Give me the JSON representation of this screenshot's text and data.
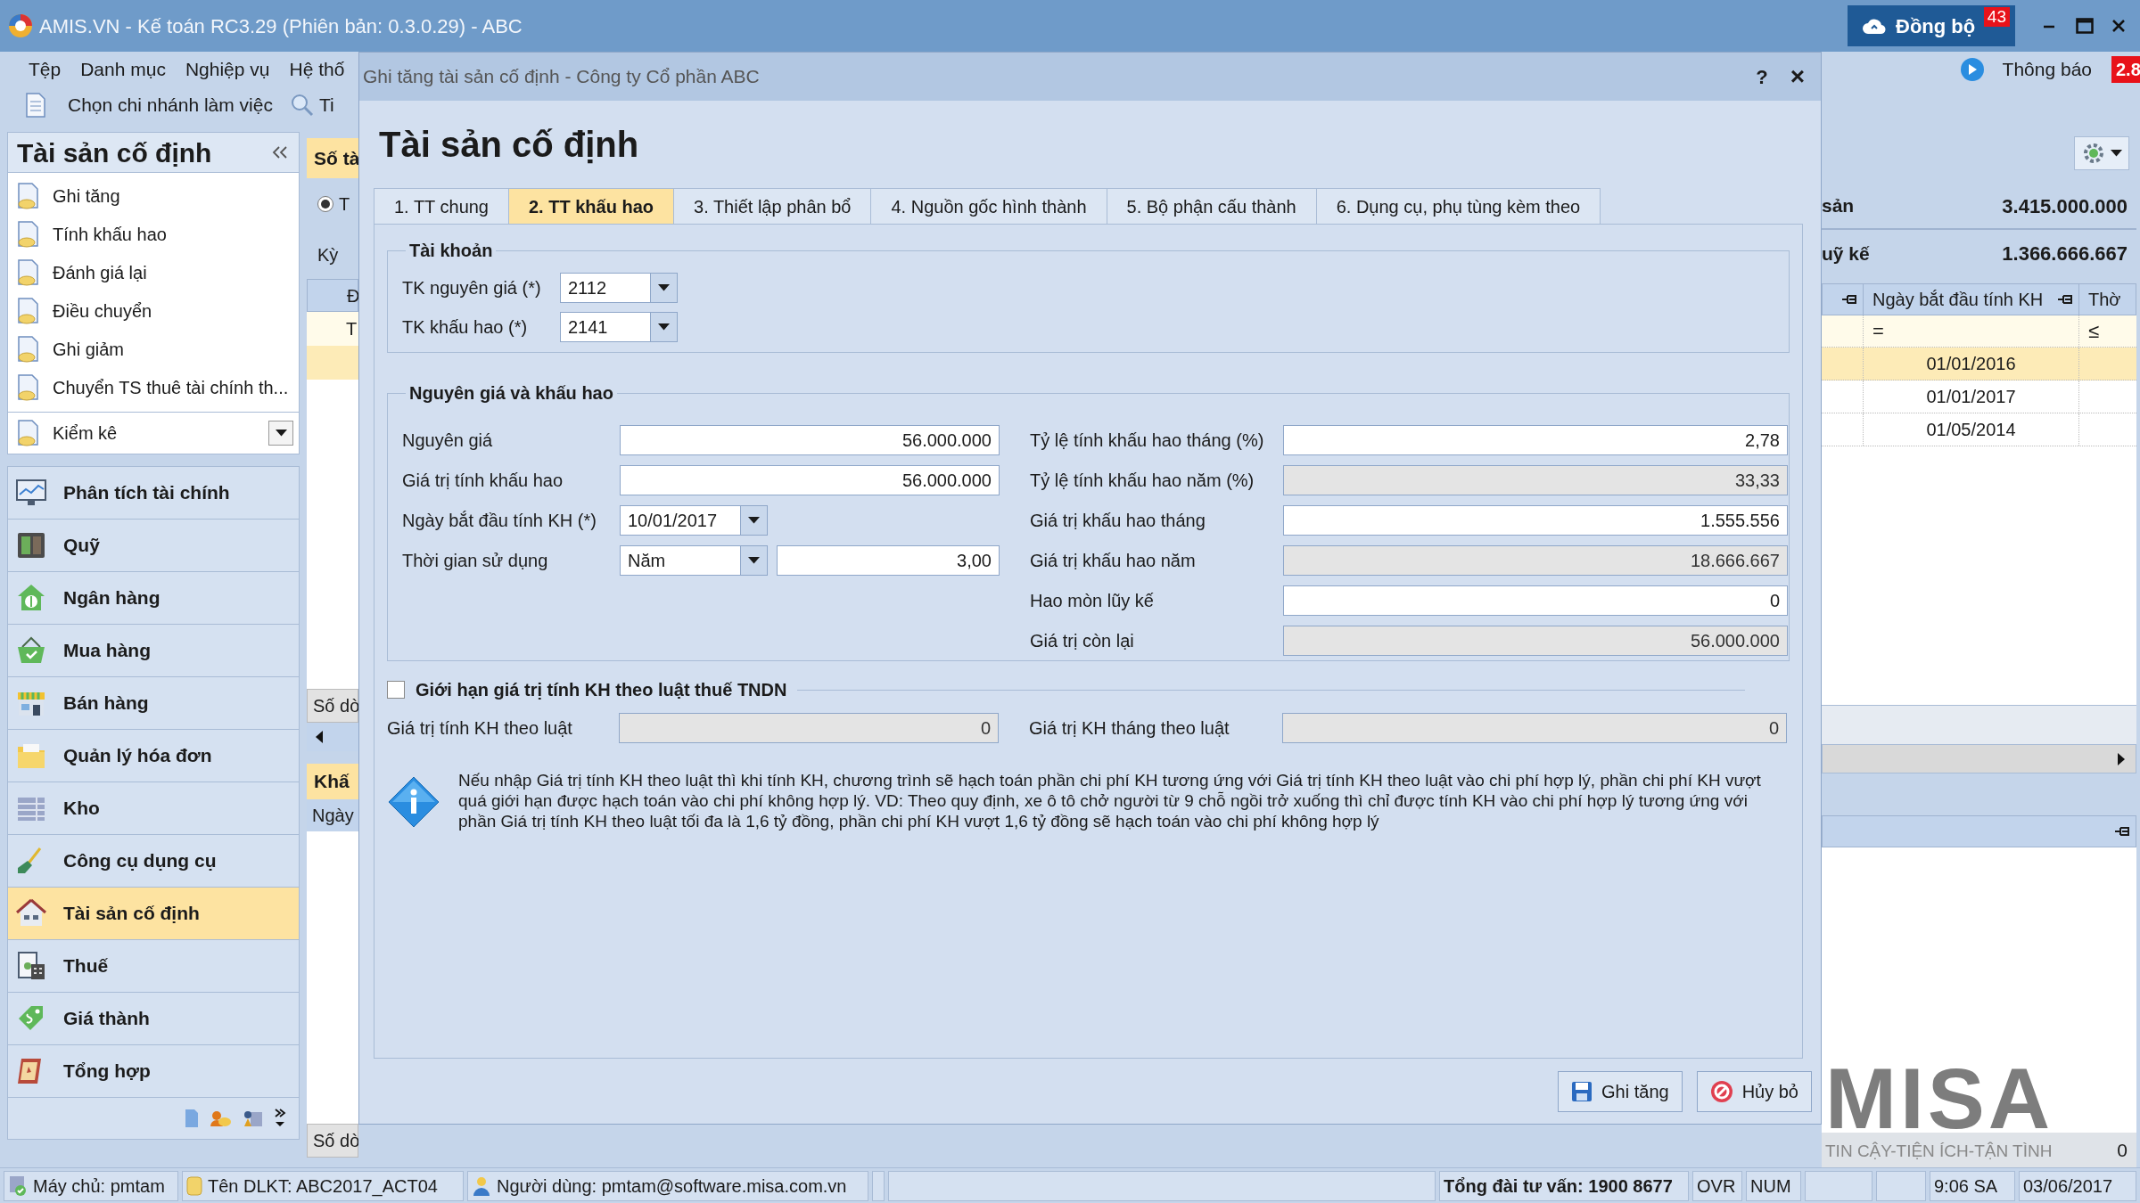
{
  "window": {
    "title": "AMIS.VN - Kế toán RC3.29 (Phiên bản: 0.3.0.29) - ABC",
    "sync": {
      "label": "Đồng bộ",
      "badge": "43"
    }
  },
  "menu": [
    {
      "label": "Tệp"
    },
    {
      "label": "Danh mục"
    },
    {
      "label": "Nghiệp vụ"
    },
    {
      "label": "Hệ thố"
    }
  ],
  "toolbar": {
    "branch": "Chọn chi nhánh làm việc",
    "search": "Ti"
  },
  "notifications": {
    "label": "Thông báo",
    "badge": "2.8"
  },
  "sidebar": {
    "title": "Tài sản cố định",
    "items": [
      {
        "label": "Ghi tăng"
      },
      {
        "label": "Tính khấu hao"
      },
      {
        "label": "Đánh giá lại"
      },
      {
        "label": "Điều chuyển"
      },
      {
        "label": "Ghi giảm"
      },
      {
        "label": "Chuyển TS thuê tài chính th..."
      }
    ],
    "more_item": "Kiểm kê",
    "modules": [
      {
        "label": "Phân tích tài chính",
        "selected": false
      },
      {
        "label": "Quỹ",
        "selected": false
      },
      {
        "label": "Ngân hàng",
        "selected": false
      },
      {
        "label": "Mua hàng",
        "selected": false
      },
      {
        "label": "Bán hàng",
        "selected": false
      },
      {
        "label": "Quản lý hóa đơn",
        "selected": false
      },
      {
        "label": "Kho",
        "selected": false
      },
      {
        "label": "Công cụ dụng cụ",
        "selected": false
      },
      {
        "label": "Tài sản cố định",
        "selected": true
      },
      {
        "label": "Thuế",
        "selected": false
      },
      {
        "label": "Giá thành",
        "selected": false
      },
      {
        "label": "Tổng hợp",
        "selected": false
      }
    ]
  },
  "left_panel": {
    "tab": "Số tà",
    "radio": {
      "label": "T",
      "selected": true
    },
    "period": "Kỳ",
    "grid_header": "Đ",
    "grid_row": "T",
    "footer": "Số dò",
    "tab2": "Khấ",
    "grid2_header": "Ngày",
    "footer2": "Số dò"
  },
  "right_panel": {
    "totals": [
      {
        "label": "sản",
        "value": "3.415.000.000"
      },
      {
        "label": "uỹ kế",
        "value": "1.366.666.667"
      }
    ],
    "columns": [
      "Ngày bắt đầu tính KH",
      "Thờ"
    ],
    "filters": [
      "=",
      "≤"
    ],
    "rows": [
      {
        "date": "01/01/2016",
        "selected": true
      },
      {
        "date": "01/01/2017",
        "selected": false
      },
      {
        "date": "01/05/2014",
        "selected": false
      }
    ],
    "footer": "0"
  },
  "dialog": {
    "title": "Ghi tăng tài sản cố định - Công ty Cổ phần ABC",
    "help": "?",
    "close": "×",
    "heading": "Tài sản cố định",
    "tabs": [
      {
        "label": "1. TT chung",
        "selected": false
      },
      {
        "label": "2. TT khấu hao",
        "selected": true
      },
      {
        "label": "3. Thiết lập phân bổ",
        "selected": false
      },
      {
        "label": "4. Nguồn gốc hình thành",
        "selected": false
      },
      {
        "label": "5. Bộ phận cấu thành",
        "selected": false
      },
      {
        "label": "6. Dụng cụ, phụ tùng kèm theo",
        "selected": false
      }
    ],
    "accounts": {
      "title": "Tài khoản",
      "fields": [
        {
          "label": "TK nguyên giá (*)",
          "value": "2112"
        },
        {
          "label": "TK khấu hao (*)",
          "value": "2141"
        }
      ]
    },
    "depreciation": {
      "title": "Nguyên giá và khấu hao",
      "left": [
        {
          "kind": "text",
          "label": "Nguyên giá",
          "value": "56.000.000"
        },
        {
          "kind": "text",
          "label": "Giá trị tính khấu hao",
          "value": "56.000.000"
        },
        {
          "kind": "combo",
          "label": "Ngày bắt đầu tính KH (*)",
          "value": "10/01/2017"
        },
        {
          "kind": "combo_number",
          "label": "Thời gian sử dụng",
          "value": "Năm",
          "number": "3,00"
        }
      ],
      "right": [
        {
          "label": "Tỷ lệ tính khấu hao tháng (%)",
          "value": "2,78",
          "readonly": false
        },
        {
          "label": "Tỷ lệ tính khấu hao năm (%)",
          "value": "33,33",
          "readonly": true
        },
        {
          "label": "Giá trị khấu hao tháng",
          "value": "1.555.556",
          "readonly": false
        },
        {
          "label": "Giá trị khấu hao năm",
          "value": "18.666.667",
          "readonly": true
        },
        {
          "label": "Hao mòn lũy kế",
          "value": "0",
          "readonly": false
        },
        {
          "label": "Giá trị còn lại",
          "value": "56.000.000",
          "readonly": true
        }
      ]
    },
    "tax_limit": {
      "label": "Giới hạn giá trị tính KH theo luật thuế TNDN",
      "checked": false,
      "fields": [
        {
          "label": "Giá trị tính KH theo luật",
          "value": "0",
          "readonly": true
        },
        {
          "label": "Giá trị KH tháng theo luật",
          "value": "0",
          "readonly": true
        }
      ]
    },
    "note": "Nếu nhập Giá trị tính KH theo luật thì khi tính KH, chương trình sẽ hạch toán phần chi phí KH tương ứng với Giá trị tính KH theo luật vào chi phí hợp lý, phần chi phí KH vượt quá giới hạn được hạch toán vào chi phí không hợp lý. VD: Theo quy định, xe ô tô chở người từ 9 chỗ ngồi trở xuống thì chỉ được tính KH vào chi phí hợp lý tương ứng với phần Giá trị tính KH theo luật tối đa là 1,6 tỷ đồng, phần chi phí KH vượt 1,6 tỷ đồng sẽ hạch toán vào chi phí không hợp lý",
    "buttons": [
      {
        "label": "Ghi tăng",
        "kind": "save"
      },
      {
        "label": "Hủy bỏ",
        "kind": "cancel"
      }
    ]
  },
  "logo": {
    "name": "MISA",
    "tagline": "TIN CẬY-TIỆN ÍCH-TẬN TÌNH"
  },
  "status_bar": {
    "server": "Máy chủ: pmtam",
    "database": "Tên DLKT: ABC2017_ACT04",
    "user": "Người dùng: pmtam@software.misa.com.vn",
    "hotline": "Tổng đài tư vấn: 1900 8677",
    "ovr": "OVR",
    "num": "NUM",
    "time": "9:06 SA",
    "date": "03/06/2017"
  }
}
